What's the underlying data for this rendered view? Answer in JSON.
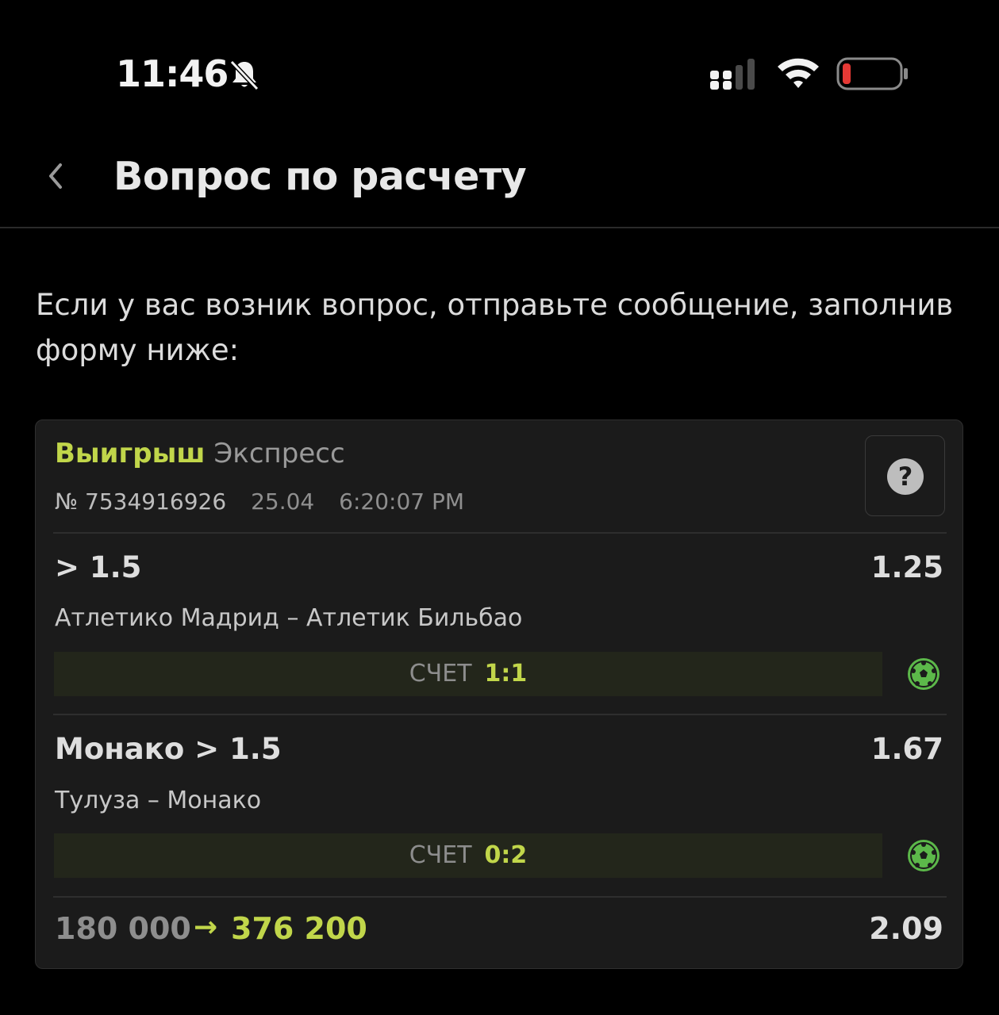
{
  "status_bar": {
    "time": "11:46",
    "icons": [
      "bell-slash-icon",
      "signal-icon",
      "wifi-icon",
      "battery-low-icon"
    ]
  },
  "header": {
    "back_icon": "chevron-left-icon",
    "title": "Вопрос по расчету"
  },
  "intro": "Если у вас возник вопрос, отправьте сообщение, заполнив форму ниже:",
  "bet": {
    "status": "Выигрыш",
    "type": "Экспресс",
    "number": "№ 7534916926",
    "date": "25.04",
    "time": "6:20:07 PM",
    "help_icon": "question-circle-icon",
    "selections": [
      {
        "name": "> 1.5",
        "odds": "1.25",
        "match": "Атлетико Мадрид – Атлетик Бильбао",
        "score_label": "СЧЕТ",
        "score": "1:1",
        "sport_icon": "soccer-ball-icon"
      },
      {
        "name": "Монако > 1.5",
        "odds": "1.67",
        "match": "Тулуза – Монако",
        "score_label": "СЧЕТ",
        "score": "0:2",
        "sport_icon": "soccer-ball-icon"
      }
    ],
    "stake": "180 000",
    "arrow": "→",
    "payout": "376 200",
    "total_odds": "2.09"
  },
  "colors": {
    "background": "#000000",
    "card": "#1b1b1b",
    "accent": "#c1d64a",
    "score_bar": "#23261b",
    "battery_low": "#e53935",
    "ball": "#5cb84a"
  }
}
